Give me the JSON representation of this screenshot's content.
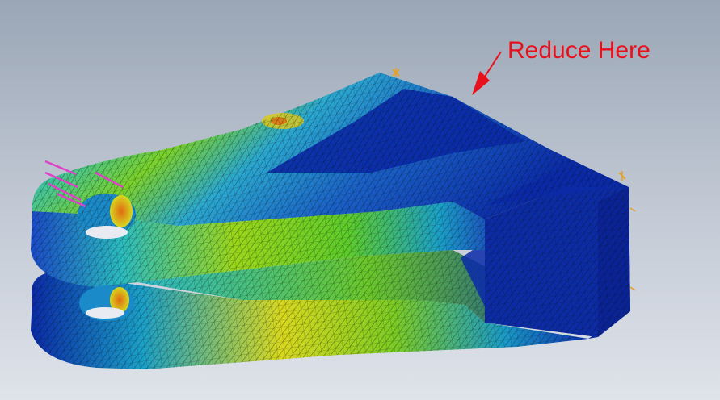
{
  "annotation": {
    "text": "Reduce Here",
    "color": "#e8101a"
  },
  "colors": {
    "background_top": "#9aa6b6",
    "background_bottom": "#dfe3ea",
    "mesh_line": "#0a0a0a",
    "stress_low": "#0a2aa8",
    "stress_mid_low": "#1aa6c8",
    "stress_mid": "#66d02a",
    "stress_mid_high": "#d6d81e",
    "stress_high": "#e06a12",
    "load_arrow": "#e040c8",
    "fixture_marker": "#e8a020"
  },
  "icons": {
    "load": "force-arrow-icon",
    "fixture": "fixed-restraint-icon"
  }
}
